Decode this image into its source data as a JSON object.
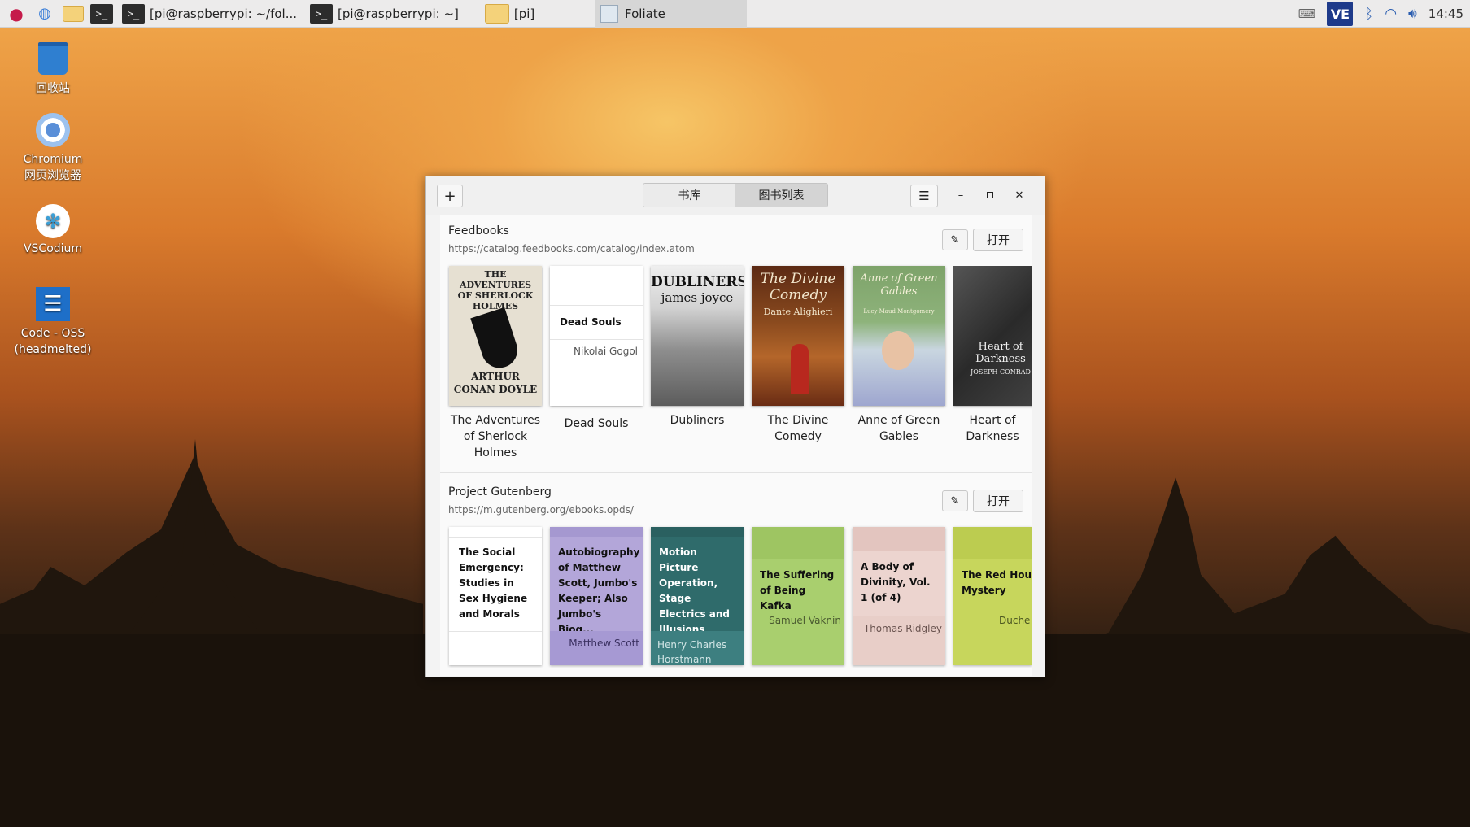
{
  "taskbar": {
    "tasks": [
      "[pi@raspberrypi: ~/fol...",
      "[pi@raspberrypi: ~]",
      "[pi]"
    ],
    "active_app": "Foliate",
    "ve_label": "VE",
    "clock": "14:45"
  },
  "desktop": {
    "icons": [
      "回收站",
      "Chromium 网页浏览器",
      "VSCodium",
      "Code - OSS (headmelted)"
    ]
  },
  "window": {
    "tabs": [
      "书库",
      "图书列表"
    ],
    "active_tab": "图书列表",
    "feedbooks": {
      "name": "Feedbooks",
      "url": "https://catalog.feedbooks.com/catalog/index.atom",
      "open_label": "打开",
      "books": [
        {
          "title": "The Adventures of Sherlock Holmes",
          "cover_top": "THE ADVENTURES OF SHERLOCK HOLMES",
          "cover_bottom": "ARTHUR CONAN DOYLE"
        },
        {
          "title": "Dead Souls",
          "cover_title": "Dead Souls",
          "cover_author": "Nikolai Gogol"
        },
        {
          "title": "Dubliners",
          "cover_top": "DUBLINERS",
          "cover_sub": "james joyce"
        },
        {
          "title": "The Divine Comedy",
          "cover_top": "The Divine Comedy",
          "cover_sub": "Dante Alighieri"
        },
        {
          "title": "Anne of Green Gables",
          "cover_top": "Anne of Green Gables",
          "cover_sub": "Lucy Maud Montgomery"
        },
        {
          "title": "Heart of Darkness",
          "cover_top": "Heart of Darkness",
          "cover_sub": "JOSEPH CONRAD"
        }
      ]
    },
    "gutenberg": {
      "name": "Project Gutenberg",
      "url": "https://m.gutenberg.org/ebooks.opds/",
      "open_label": "打开",
      "books": [
        {
          "title": "The Social Emergency: Studies in Sex Hygiene and Morals",
          "author": ""
        },
        {
          "title": "Autobiography of Matthew Scott, Jumbo's Keeper; Also Jumbo's Biog...",
          "author": "Matthew Scott"
        },
        {
          "title": "Motion Picture Operation, Stage Electrics and Illusions",
          "author": "Henry Charles Horstmann and..."
        },
        {
          "title": "The Suffering of Being Kafka",
          "author": "Samuel Vaknin"
        },
        {
          "title": "A Body of Divinity, Vol. 1 (of 4)",
          "author": "Thomas Ridgley"
        },
        {
          "title": "The Red House Mystery",
          "author": "Duche"
        }
      ]
    }
  },
  "colors": {
    "gut_cover_1": "#ffffff",
    "gut_cover_2": "#b3a6d9",
    "gut_cover_3": "#2f6b6b",
    "gut_cover_4": "#a9cf6e",
    "gut_cover_5": "#ecd4cf",
    "gut_cover_6": "#c7d65c"
  }
}
